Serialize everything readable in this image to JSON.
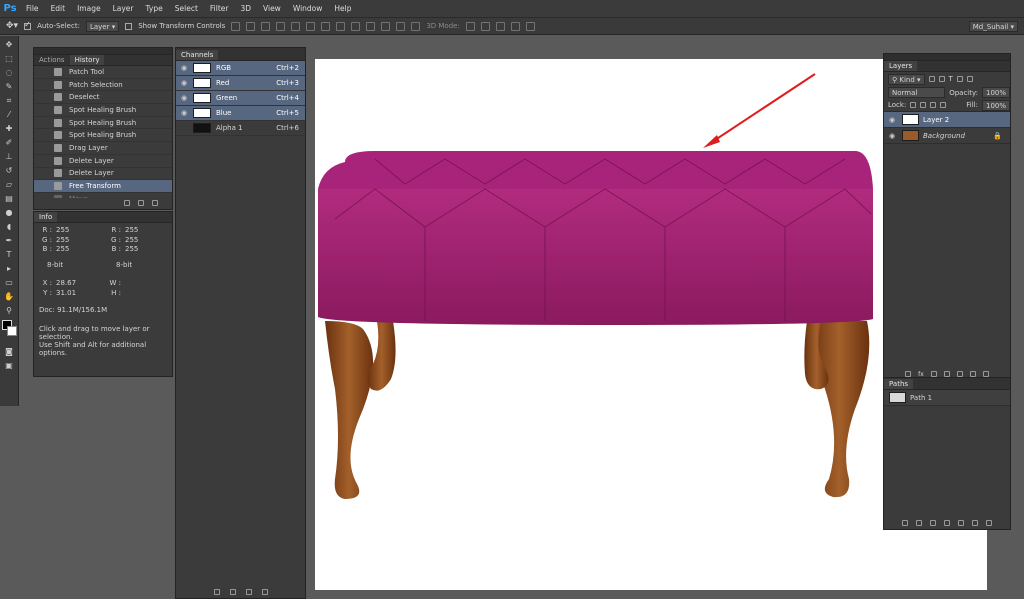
{
  "app": {
    "logo": "Ps",
    "user": "Md_Suhail"
  },
  "menu": [
    "File",
    "Edit",
    "Image",
    "Layer",
    "Type",
    "Select",
    "Filter",
    "3D",
    "View",
    "Window",
    "Help"
  ],
  "options": {
    "auto_select_label": "Auto-Select:",
    "auto_select_value": "Layer",
    "show_transform_label": "Show Transform Controls",
    "mode_3d_label": "3D Mode:"
  },
  "history": {
    "tabs": [
      "Actions",
      "History"
    ],
    "items": [
      "Patch Tool",
      "Patch Selection",
      "Deselect",
      "Spot Healing Brush",
      "Spot Healing Brush",
      "Spot Healing Brush",
      "Drag Layer",
      "Delete Layer",
      "Delete Layer",
      "Free Transform",
      "Move"
    ],
    "selected_index": 9
  },
  "info": {
    "tab": "Info",
    "left": {
      "R": "255",
      "G": "255",
      "B": "255",
      "bit": "8-bit"
    },
    "right": {
      "R": "255",
      "G": "255",
      "B": "255",
      "bit": "8-bit"
    },
    "X": "28.67",
    "Y": "31.01",
    "W": "",
    "H": "",
    "doc": "Doc: 91.1M/156.1M",
    "hint1": "Click and drag to move layer or selection.",
    "hint2": "Use Shift and Alt for additional options."
  },
  "channels": {
    "tab": "Channels",
    "items": [
      {
        "name": "RGB",
        "shortcut": "Ctrl+2",
        "selected": true
      },
      {
        "name": "Red",
        "shortcut": "Ctrl+3",
        "selected": true
      },
      {
        "name": "Green",
        "shortcut": "Ctrl+4",
        "selected": true
      },
      {
        "name": "Blue",
        "shortcut": "Ctrl+5",
        "selected": true
      },
      {
        "name": "Alpha 1",
        "shortcut": "Ctrl+6",
        "selected": false
      }
    ]
  },
  "layers": {
    "tab": "Layers",
    "kind": "Kind",
    "blend": "Normal",
    "opacity_label": "Opacity:",
    "opacity": "100%",
    "lock_label": "Lock:",
    "fill_label": "Fill:",
    "fill": "100%",
    "items": [
      {
        "name": "Layer 2",
        "selected": true
      },
      {
        "name": "Background",
        "selected": false
      }
    ]
  },
  "paths": {
    "tab": "Paths",
    "items": [
      "Path 1"
    ]
  },
  "colors": {
    "accent": "#31a8ff",
    "selection": "#586780",
    "bench_fabric": "#9c1e6a",
    "bench_wood": "#8a4a1c",
    "arrow": "#e11b1b"
  }
}
